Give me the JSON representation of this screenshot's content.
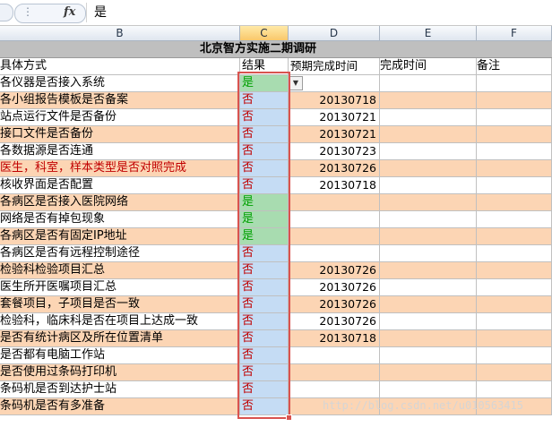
{
  "formula_bar": {
    "fx_label": "fx",
    "content": "是"
  },
  "columns": [
    "B",
    "C",
    "D",
    "E",
    "F"
  ],
  "selected_column": "C",
  "sheet_title": "北京智方实施二期调研",
  "headers": {
    "b": "具体方式",
    "c": "结果",
    "d": "预期完成时间",
    "e": "完成时间",
    "f": "备注"
  },
  "colors": {
    "orange_row": "#fcd5b4",
    "green_result": "#a8dcb0",
    "blue_result": "#c5dcf4",
    "selection_border": "#d9534f",
    "no_text": "#c00000",
    "yes_text": "#00a000"
  },
  "rows": [
    {
      "item": "各仪器是否接入系统",
      "result": "是",
      "expected": "",
      "style": "white",
      "rstyle": "green",
      "dropdown": true
    },
    {
      "item": "各小组报告模板是否备案",
      "result": "否",
      "expected": "20130718",
      "style": "orange",
      "rstyle": "blue"
    },
    {
      "item": "站点运行文件是否备份",
      "result": "否",
      "expected": "20130721",
      "style": "white",
      "rstyle": "blue"
    },
    {
      "item": "接口文件是否备份",
      "result": "否",
      "expected": "20130721",
      "style": "orange",
      "rstyle": "blue"
    },
    {
      "item": "各数据源是否连通",
      "result": "否",
      "expected": "20130723",
      "style": "white",
      "rstyle": "blue"
    },
    {
      "item": "医生，科室，样本类型是否对照完成",
      "result": "否",
      "expected": "20130726",
      "style": "orange",
      "rstyle": "blue",
      "redtext": true
    },
    {
      "item": "核收界面是否配置",
      "result": "否",
      "expected": "20130718",
      "style": "white",
      "rstyle": "blue"
    },
    {
      "item": "各病区是否接入医院网络",
      "result": "是",
      "expected": "",
      "style": "orange",
      "rstyle": "green"
    },
    {
      "item": "网络是否有掉包现象",
      "result": "是",
      "expected": "",
      "style": "white",
      "rstyle": "green"
    },
    {
      "item": "各病区是否有固定IP地址",
      "result": "是",
      "expected": "",
      "style": "orange",
      "rstyle": "green"
    },
    {
      "item": "各病区是否有远程控制途径",
      "result": "否",
      "expected": "",
      "style": "white",
      "rstyle": "blue"
    },
    {
      "item": "检验科检验项目汇总",
      "result": "否",
      "expected": "20130726",
      "style": "orange",
      "rstyle": "blue"
    },
    {
      "item": "医生所开医嘱项目汇总",
      "result": "否",
      "expected": "20130726",
      "style": "white",
      "rstyle": "blue"
    },
    {
      "item": "套餐项目，子项目是否一致",
      "result": "否",
      "expected": "20130726",
      "style": "orange",
      "rstyle": "blue"
    },
    {
      "item": "检验科，临床科是否在项目上达成一致",
      "result": "否",
      "expected": "20130726",
      "style": "white",
      "rstyle": "blue"
    },
    {
      "item": "是否有统计病区及所在位置清单",
      "result": "否",
      "expected": "20130718",
      "style": "orange",
      "rstyle": "blue"
    },
    {
      "item": "是否都有电脑工作站",
      "result": "否",
      "expected": "",
      "style": "white",
      "rstyle": "blue"
    },
    {
      "item": "是否使用过条码打印机",
      "result": "否",
      "expected": "",
      "style": "orange",
      "rstyle": "blue"
    },
    {
      "item": "条码机是否到达护士站",
      "result": "否",
      "expected": "",
      "style": "white",
      "rstyle": "blue"
    },
    {
      "item": "条码机是否有多准备",
      "result": "否",
      "expected": "",
      "style": "orange",
      "rstyle": "blue"
    }
  ],
  "watermark": "http://blog.csdn.net/u010563415"
}
